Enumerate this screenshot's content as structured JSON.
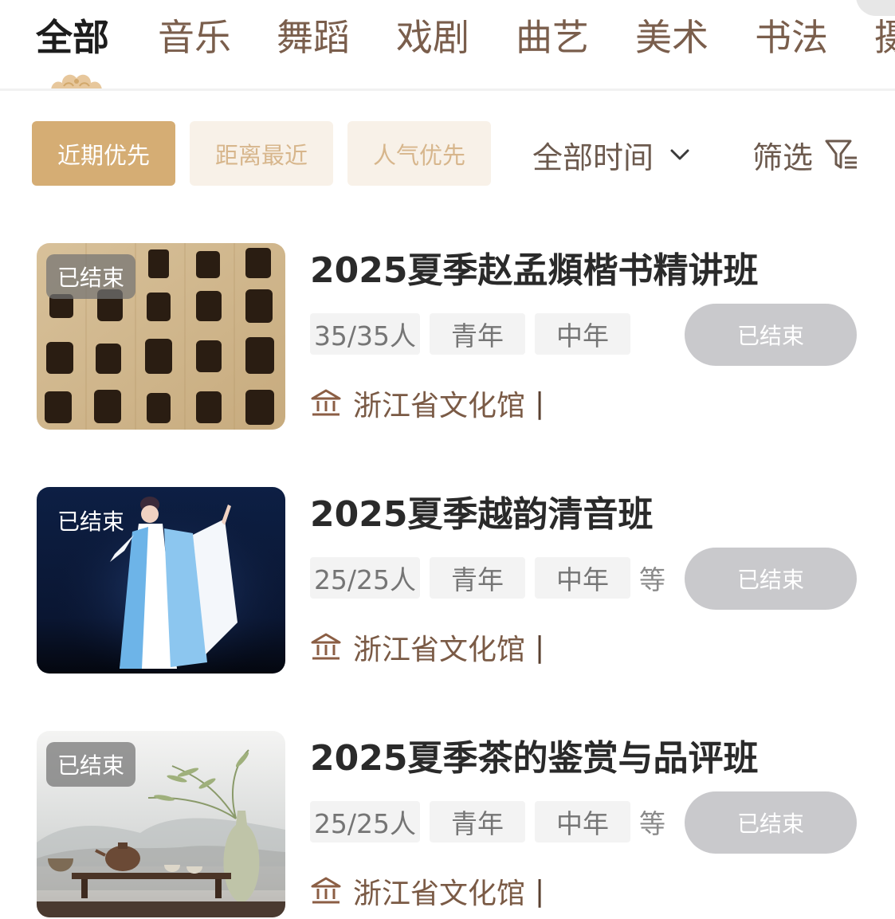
{
  "tabs": [
    "全部",
    "音乐",
    "舞蹈",
    "戏剧",
    "曲艺",
    "美术",
    "书法",
    "摄"
  ],
  "sort": {
    "recent": "近期优先",
    "nearest": "距离最近",
    "popular": "人气优先",
    "time_filter": "全部时间",
    "filter": "筛选"
  },
  "courses": [
    {
      "badge": "已结束",
      "title": "2025夏季赵孟頫楷书精讲班",
      "enrollment": "35/35人",
      "tags": [
        "青年",
        "中年"
      ],
      "more": "",
      "status": "已结束",
      "venue": "浙江省文化馆",
      "venue_sep": "|"
    },
    {
      "badge": "已结束",
      "title": "2025夏季越韵清音班",
      "enrollment": "25/25人",
      "tags": [
        "青年",
        "中年"
      ],
      "more": "等",
      "status": "已结束",
      "venue": "浙江省文化馆",
      "venue_sep": "|"
    },
    {
      "badge": "已结束",
      "title": "2025夏季茶的鉴赏与品评班",
      "enrollment": "25/25人",
      "tags": [
        "青年",
        "中年"
      ],
      "more": "等",
      "status": "已结束",
      "venue": "浙江省文化馆",
      "venue_sep": "|"
    }
  ],
  "colors": {
    "accent": "#d5ad74",
    "chip_idle_bg": "#f8f1e8",
    "brown_text": "#7a5a45",
    "status_gray": "#c9c9cc"
  },
  "icons": {
    "tab_indicator": "auspicious-cloud-icon",
    "dropdown": "chevron-down-icon",
    "filter": "filter-icon",
    "venue": "museum-icon"
  }
}
